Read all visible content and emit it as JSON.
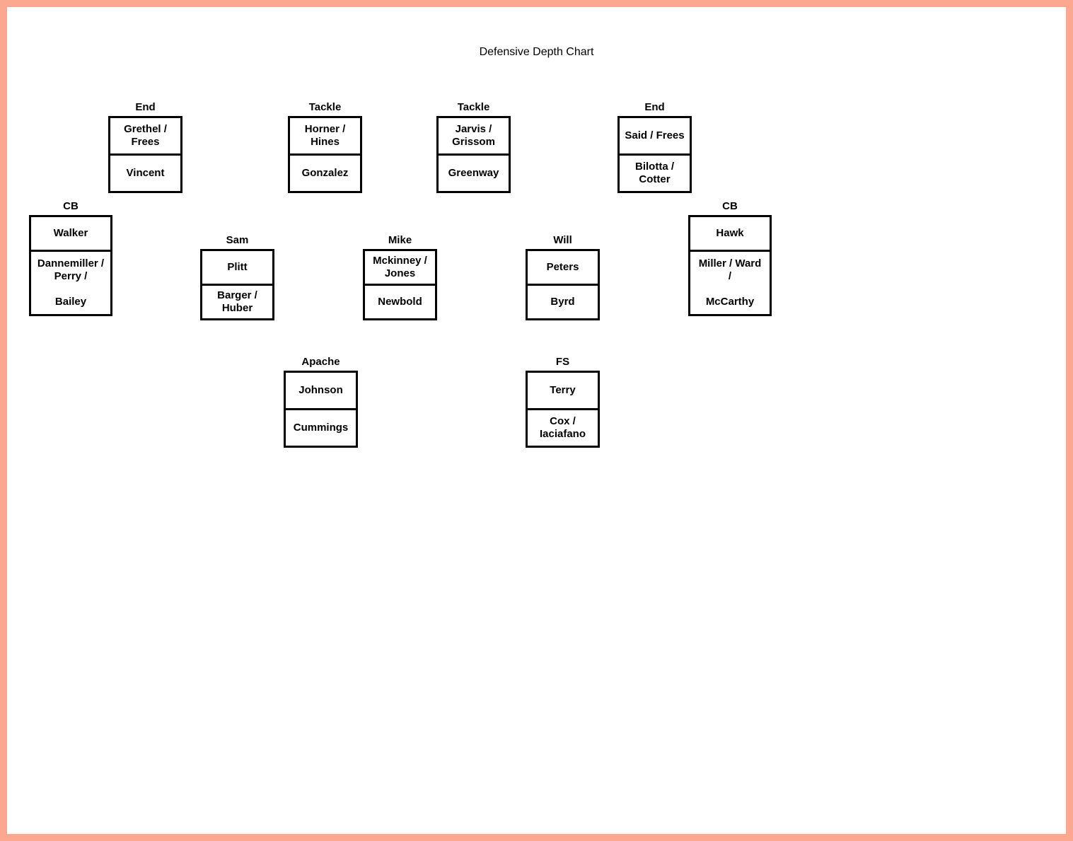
{
  "title": "Defensive Depth Chart",
  "positions": {
    "dl_end_left": {
      "label": "End",
      "starter": "Grethel /\nFrees",
      "backup": "Vincent"
    },
    "dl_tackle_l": {
      "label": "Tackle",
      "starter": "Horner /\nHines",
      "backup": "Gonzalez"
    },
    "dl_tackle_r": {
      "label": "Tackle",
      "starter": "Jarvis /\nGrissom",
      "backup": "Greenway"
    },
    "dl_end_right": {
      "label": "End",
      "starter": "Said / Frees",
      "backup": "Bilotta /\nCotter"
    },
    "cb_left": {
      "label": "CB",
      "starter": "Walker",
      "backup": "Dannemiller /\nPerry /\n\nBailey"
    },
    "lb_sam": {
      "label": "Sam",
      "starter": "Plitt",
      "backup": "Barger /\nHuber"
    },
    "lb_mike": {
      "label": "Mike",
      "starter": "Mckinney /\nJones",
      "backup": "Newbold"
    },
    "lb_will": {
      "label": "Will",
      "starter": "Peters",
      "backup": "Byrd"
    },
    "cb_right": {
      "label": "CB",
      "starter": "Hawk",
      "backup": "Miller / Ward\n/\n\nMcCarthy"
    },
    "s_apache": {
      "label": "Apache",
      "starter": "Johnson",
      "backup": "Cummings"
    },
    "s_fs": {
      "label": "FS",
      "starter": "Terry",
      "backup": "Cox /\nIaciafano"
    }
  }
}
